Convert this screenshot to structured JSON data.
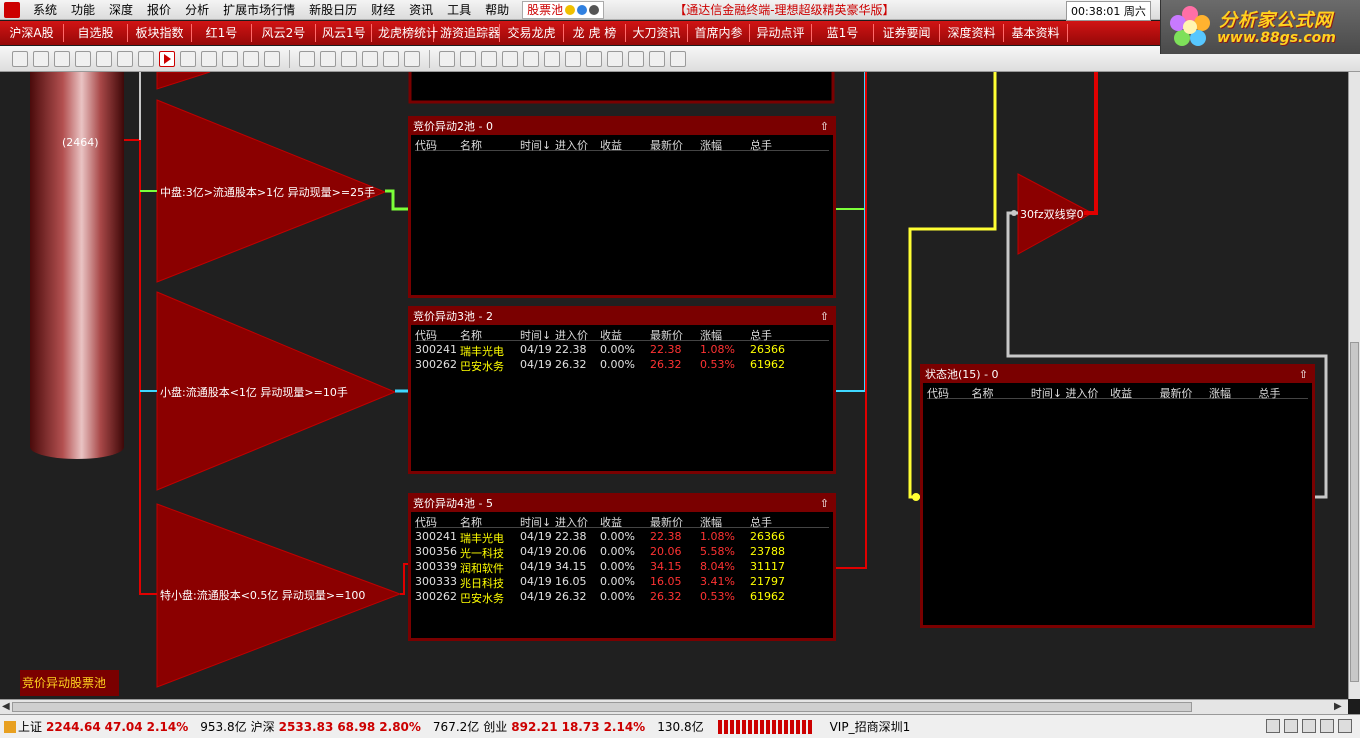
{
  "menu": {
    "items": [
      "系统",
      "功能",
      "深度",
      "报价",
      "分析",
      "扩展市场行情",
      "新股日历",
      "财经",
      "资讯",
      "工具",
      "帮助"
    ],
    "pool_tab": "股票池",
    "brand_title": "【通达信金融终端-理想超级精英豪华版】",
    "clock": "00:38:01 周六"
  },
  "logo": {
    "name": "分析家公式网",
    "url": "www.88gs.com"
  },
  "tabs": [
    "沪深A股",
    "自选股",
    "板块指数",
    "红1号",
    "风云2号",
    "风云1号",
    "龙虎榜统计",
    "游资追踪器",
    "交易龙虎",
    "龙 虎 榜",
    "大刀资讯",
    "首席内参",
    "异动点评",
    "蓝1号",
    "证券要闻",
    "深度资料",
    "基本资料"
  ],
  "canvas": {
    "cylinder_count": "(2464)",
    "pool_caption": "竞价异动股票池",
    "triangles": [
      {
        "label": "中盘:3亿>流通股本>1亿  异动现量>=25手"
      },
      {
        "label": "小盘:流通股本<1亿  异动现量>=10手"
      },
      {
        "label": "特小盘:流通股本<0.5亿  异动现量>=100"
      },
      {
        "label": "30fz双线穿0"
      }
    ]
  },
  "columns": [
    "代码",
    "名称",
    "时间↓",
    "进入价",
    "收益",
    "最新价",
    "涨幅",
    "总手"
  ],
  "panels": [
    {
      "title": "竞价异动2池 - 0",
      "rows": []
    },
    {
      "title": "竞价异动3池 - 2",
      "rows": [
        {
          "code": "300241",
          "name": "瑞丰光电",
          "time": "04/19",
          "entry": "22.38",
          "ret": "0.00%",
          "last": "22.38",
          "chg": "1.08%",
          "vol": "26366"
        },
        {
          "code": "300262",
          "name": "巴安水务",
          "time": "04/19",
          "entry": "26.32",
          "ret": "0.00%",
          "last": "26.32",
          "chg": "0.53%",
          "vol": "61962"
        }
      ]
    },
    {
      "title": "竞价异动4池 - 5",
      "rows": [
        {
          "code": "300241",
          "name": "瑞丰光电",
          "time": "04/19",
          "entry": "22.38",
          "ret": "0.00%",
          "last": "22.38",
          "chg": "1.08%",
          "vol": "26366"
        },
        {
          "code": "300356",
          "name": "光一科技",
          "time": "04/19",
          "entry": "20.06",
          "ret": "0.00%",
          "last": "20.06",
          "chg": "5.58%",
          "vol": "23788"
        },
        {
          "code": "300339",
          "name": "润和软件",
          "time": "04/19",
          "entry": "34.15",
          "ret": "0.00%",
          "last": "34.15",
          "chg": "8.04%",
          "vol": "31117"
        },
        {
          "code": "300333",
          "name": "兆日科技",
          "time": "04/19",
          "entry": "16.05",
          "ret": "0.00%",
          "last": "16.05",
          "chg": "3.41%",
          "vol": "21797"
        },
        {
          "code": "300262",
          "name": "巴安水务",
          "time": "04/19",
          "entry": "26.32",
          "ret": "0.00%",
          "last": "26.32",
          "chg": "0.53%",
          "vol": "61962"
        }
      ]
    },
    {
      "title": "状态池(15) - 0",
      "rows": []
    }
  ],
  "statusbar": {
    "sh_label": "上证",
    "sh_value": "2244.64",
    "sh_chg": "47.04",
    "sh_pct": "2.14%",
    "sh_amt": "953.8亿",
    "hs_label": "沪深",
    "hs_value": "2533.83",
    "hs_chg": "68.98",
    "hs_pct": "2.80%",
    "hs_amt": "767.2亿",
    "cy_label": "创业",
    "cy_value": "892.21",
    "cy_chg": "18.73",
    "cy_pct": "2.14%",
    "cy_amt": "130.8亿",
    "vip": "VIP_招商深圳1"
  },
  "colors": {
    "accent_red": "#c00000",
    "panel_border": "#7a0000",
    "link_green": "#7cff3a",
    "link_cyan": "#3fd7ff",
    "link_yellow": "#ffff33",
    "link_gray": "#c8c8c8"
  }
}
